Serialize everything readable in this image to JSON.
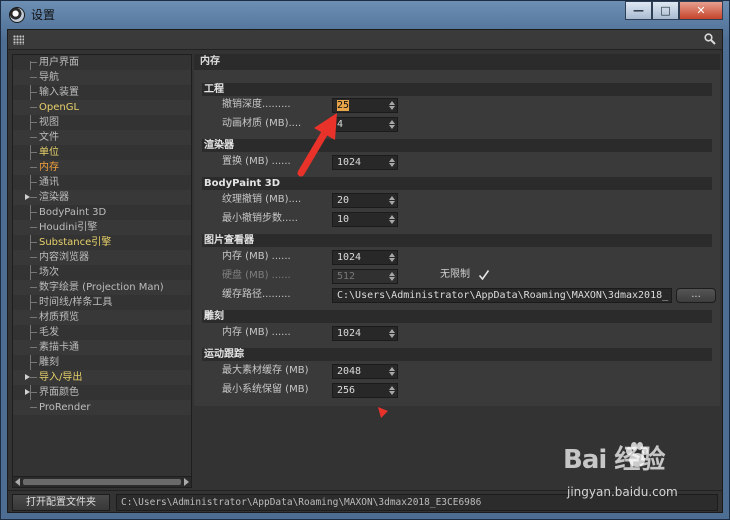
{
  "window": {
    "title": "设置",
    "minimize_glyph": "—",
    "maximize_glyph": "□",
    "close_glyph": "✕"
  },
  "sidebar": {
    "items": [
      {
        "label": "用户界面",
        "style": "normal"
      },
      {
        "label": "导航",
        "style": "normal"
      },
      {
        "label": "输入装置",
        "style": "normal"
      },
      {
        "label": "OpenGL",
        "style": "highlight"
      },
      {
        "label": "视图",
        "style": "normal"
      },
      {
        "label": "文件",
        "style": "normal"
      },
      {
        "label": "单位",
        "style": "highlight"
      },
      {
        "label": "内存",
        "style": "active"
      },
      {
        "label": "通讯",
        "style": "normal"
      },
      {
        "label": "渲染器",
        "style": "normal",
        "expandable": true
      },
      {
        "label": "BodyPaint 3D",
        "style": "normal"
      },
      {
        "label": "Houdini引擎",
        "style": "normal"
      },
      {
        "label": "Substance引擎",
        "style": "highlight"
      },
      {
        "label": "内容浏览器",
        "style": "normal"
      },
      {
        "label": "场次",
        "style": "normal"
      },
      {
        "label": "数字绘景 (Projection Man)",
        "style": "normal"
      },
      {
        "label": "时间线/样条工具",
        "style": "normal"
      },
      {
        "label": "材质预览",
        "style": "normal"
      },
      {
        "label": "毛发",
        "style": "normal"
      },
      {
        "label": "素描卡通",
        "style": "normal"
      },
      {
        "label": "雕刻",
        "style": "normal"
      },
      {
        "label": "导入/导出",
        "style": "highlight",
        "expandable": true
      },
      {
        "label": "界面颜色",
        "style": "normal",
        "expandable": true
      },
      {
        "label": "ProRender",
        "style": "normal"
      }
    ]
  },
  "panel": {
    "title": "内存",
    "sections": {
      "project": {
        "title": "工程",
        "undo_depth_label": "撤销深度.........",
        "undo_depth_value": "25",
        "anim_material_label": "动画材质 (MB)....",
        "anim_material_value": "4"
      },
      "renderer": {
        "title": "渲染器",
        "replace_label": "置换 (MB) ......",
        "replace_value": "1024"
      },
      "bodypaint": {
        "title": "BodyPaint 3D",
        "texture_undo_label": "纹理撤销 (MB)....",
        "texture_undo_value": "20",
        "min_undo_label": "最小撤销步数.....",
        "min_undo_value": "10"
      },
      "picture_viewer": {
        "title": "图片查看器",
        "memory_label": "内存 (MB) ......",
        "memory_value": "1024",
        "disk_label": "硬盘 (MB) ......",
        "disk_value": "512",
        "unlimited_label": "无限制",
        "cache_path_label": "缓存路径.........",
        "cache_path_value": "C:\\Users\\Administrator\\AppData\\Roaming\\MAXON\\3dmax2018_",
        "browse_label": "..."
      },
      "sculpt": {
        "title": "雕刻",
        "memory_label": "内存 (MB) ......",
        "memory_value": "1024"
      },
      "motion_tracking": {
        "title": "运动跟踪",
        "max_cache_label": "最大素材缓存 (MB)",
        "max_cache_value": "2048",
        "min_reserve_label": "最小系统保留 (MB)",
        "min_reserve_value": "256"
      }
    }
  },
  "footer": {
    "open_folder_label": "打开配置文件夹",
    "path": "C:\\Users\\Administrator\\AppData\\Roaming\\MAXON\\3dmax2018_E3CE6986"
  },
  "watermark": {
    "brand": "Bai  经验",
    "url": "jingyan.baidu.com"
  },
  "colors": {
    "annotation_arrow": "#e8322a",
    "active_item": "#f2a23c",
    "highlight_item": "#e8d26a",
    "selection": "#e8a54a"
  }
}
